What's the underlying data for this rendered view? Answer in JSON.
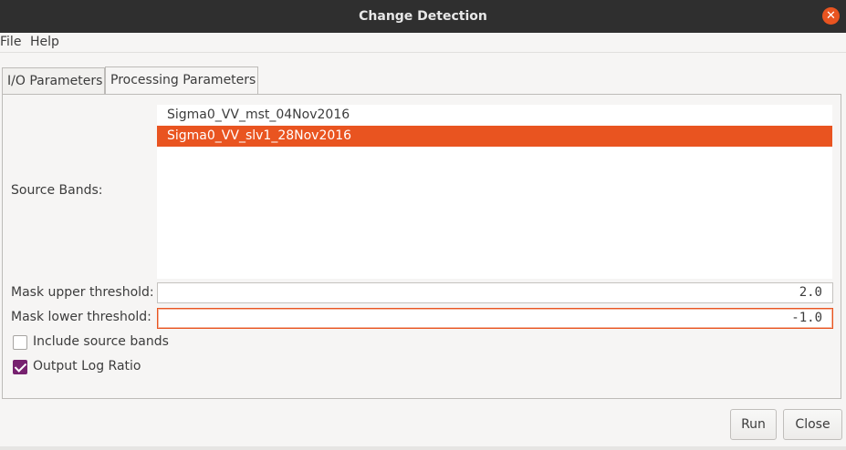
{
  "window": {
    "title": "Change Detection",
    "close_glyph": "✕",
    "accent_color": "#e95420",
    "check_color": "#77216f"
  },
  "menu": {
    "file": "File",
    "help": "Help"
  },
  "tabs": {
    "io": "I/O Parameters",
    "processing": "Processing Parameters",
    "active": "processing"
  },
  "params": {
    "source_bands_label": "Source Bands:",
    "source_bands": [
      {
        "name": "Sigma0_VV_mst_04Nov2016",
        "selected": false
      },
      {
        "name": "Sigma0_VV_slv1_28Nov2016",
        "selected": true
      }
    ],
    "mask_upper_label": "Mask upper threshold:",
    "mask_upper_value": "2.0",
    "mask_lower_label": "Mask lower threshold:",
    "mask_lower_value": "-1.0",
    "include_source_label": "Include source bands",
    "include_source_checked": false,
    "output_log_label": "Output Log Ratio",
    "output_log_checked": true
  },
  "buttons": {
    "run": "Run",
    "close": "Close"
  }
}
